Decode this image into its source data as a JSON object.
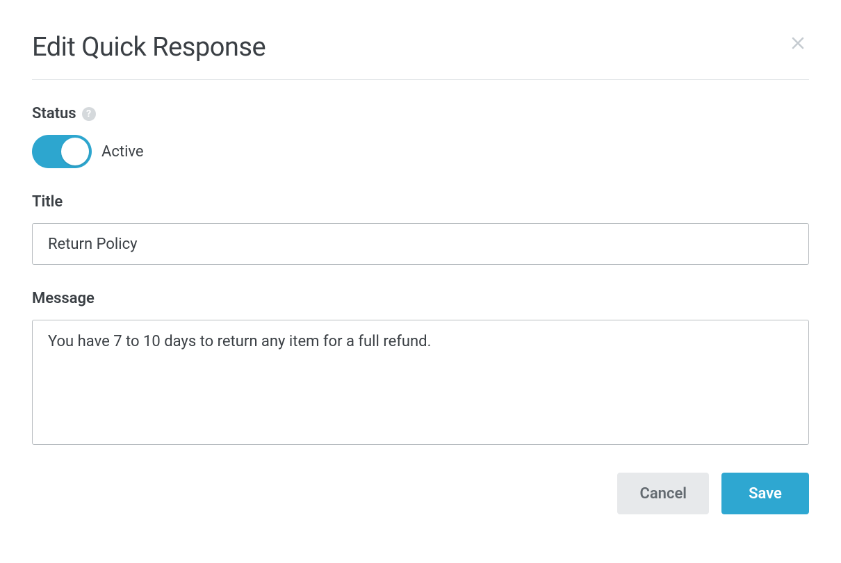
{
  "header": {
    "title": "Edit Quick Response"
  },
  "form": {
    "status": {
      "label": "Status",
      "toggle_on": true,
      "toggle_text": "Active"
    },
    "title": {
      "label": "Title",
      "value": "Return Policy"
    },
    "message": {
      "label": "Message",
      "value": "You have 7 to 10 days to return any item for a full refund."
    }
  },
  "buttons": {
    "cancel": "Cancel",
    "save": "Save"
  }
}
